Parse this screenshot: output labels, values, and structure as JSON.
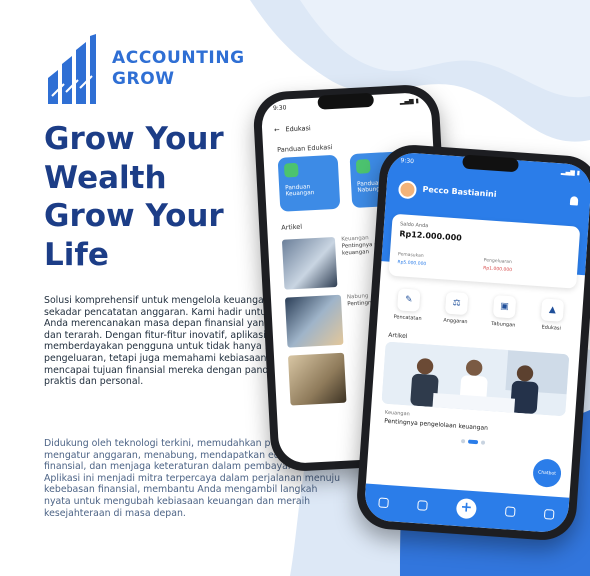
{
  "brand": {
    "name_line1": "ACCOUNTING",
    "name_line2": "GROW",
    "color": "#2f6fd4"
  },
  "headline": {
    "line1": "Grow Your",
    "line2": "Wealth",
    "line3": "Grow Your",
    "line4": "Life",
    "color": "#1c3d87"
  },
  "paragraph1": "Solusi komprehensif untuk mengelola keuangan yang lebih dari sekadar pencatatan anggaran. Kami hadir untuk membantu Anda merencanakan masa depan finansial yang lebih stabil dan terarah. Dengan fitur-fitur inovatif, aplikasi ini memberdayakan pengguna untuk tidak hanya mencatat pengeluaran, tetapi juga memahami kebiasaan keuangan dan mencapai tujuan finansial mereka dengan panduan yang praktis dan personal.",
  "paragraph2": "Didukung oleh teknologi terkini, memudahkan pengguna untuk mengatur anggaran, menabung, mendapatkan edukasi finansial, dan menjaga keteraturan dalam pembayaran. Aplikasi ini menjadi mitra terpercaya dalam perjalanan menuju kebebasan finansial, membantu Anda mengambil langkah nyata untuk mengubah kebiasaan keuangan dan meraih kesejahteraan di masa depan.",
  "phone_back": {
    "time": "9:30",
    "header_title": "Edukasi",
    "section_guides": "Panduan Edukasi",
    "card1": "Panduan Keuangan",
    "card2": "Panduan Nabung",
    "section_articles": "Artikel",
    "article1_cat": "Keuangan",
    "article1_title": "Pentingnya pengelolaan keuangan",
    "article2_cat": "Nabung",
    "article2_title": "Pentingnya menabung"
  },
  "phone_front": {
    "time": "9:30",
    "user_name": "Pecco Bastianini",
    "balance_label": "Saldo Anda",
    "balance_value": "Rp12.000.000",
    "income_label": "Pemasukan",
    "income_value": "Rp5.000.000",
    "expense_label": "Pengeluaran",
    "expense_value": "Rp1.000.000",
    "menu": [
      "Pencatatan",
      "Anggaran",
      "Tabungan",
      "Edukasi"
    ],
    "section_articles": "Artikel",
    "article_cat": "Keuangan",
    "article_title": "Pentingnya pengelolaan keuangan",
    "chat_label": "Chatbot",
    "accent": "#2b7de9"
  }
}
